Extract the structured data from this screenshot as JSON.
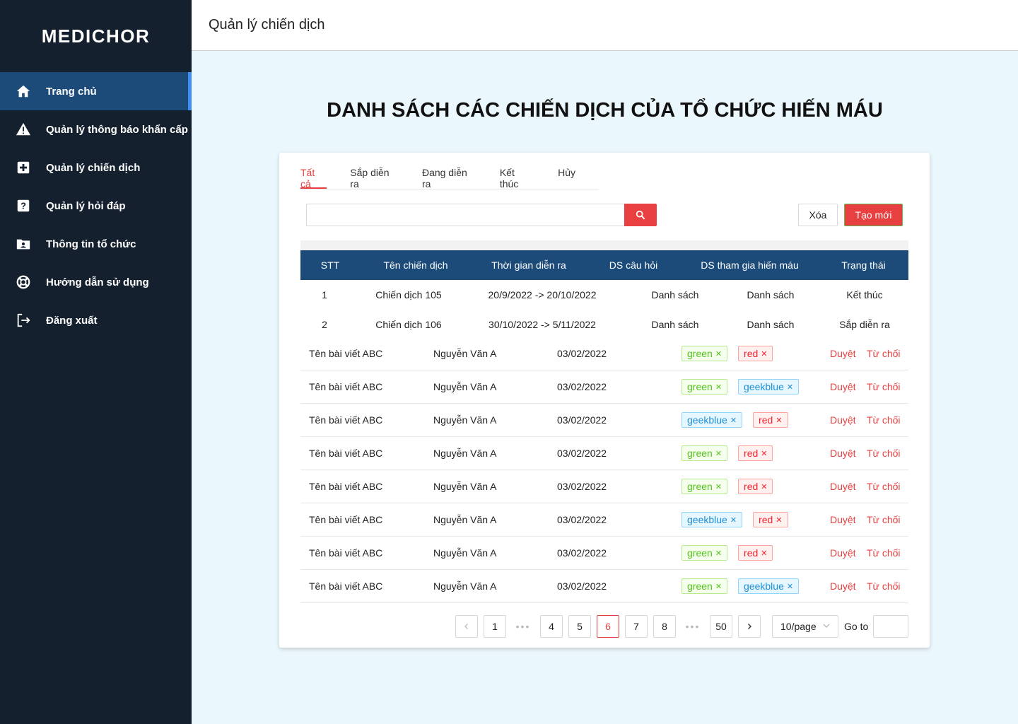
{
  "app": {
    "logo": "MEDICHOR"
  },
  "sidebar": {
    "items": [
      {
        "label": "Trang chủ",
        "icon": "home-icon"
      },
      {
        "label": "Quản lý thông báo khẩn cấp",
        "icon": "warning-icon"
      },
      {
        "label": "Quản lý chiến dịch",
        "icon": "medical-plus-icon"
      },
      {
        "label": "Quản lý hỏi đáp",
        "icon": "question-icon"
      },
      {
        "label": "Thông tin tổ chức",
        "icon": "folder-user-icon"
      },
      {
        "label": "Hướng dẫn sử dụng",
        "icon": "lifebuoy-icon"
      },
      {
        "label": "Đăng xuất",
        "icon": "logout-icon"
      }
    ],
    "active_index": 0
  },
  "header": {
    "title": "Quản lý chiến dịch"
  },
  "page": {
    "heading": "DANH SÁCH CÁC CHIẾN DỊCH CỦA TỔ CHỨC HIẾN MÁU"
  },
  "tabs": [
    "Tất cả",
    "Sắp diễn ra",
    "Đang diễn ra",
    "Kết thúc",
    "Hủy"
  ],
  "active_tab": 0,
  "search": {
    "value": "",
    "placeholder": ""
  },
  "actions": {
    "delete_label": "Xóa",
    "create_label": "Tạo mới"
  },
  "campaign_table": {
    "headers": [
      "STT",
      "Tên chiến dịch",
      "Thời gian diễn ra",
      "DS câu hỏi",
      "DS tham gia hiến máu",
      "Trạng thái"
    ],
    "rows": [
      {
        "stt": "1",
        "name": "Chiến dịch 105",
        "time": "20/9/2022 -> 20/10/2022",
        "questions": "Danh sách",
        "participants": "Danh sách",
        "status": "Kết thúc"
      },
      {
        "stt": "2",
        "name": "Chiến dịch 106",
        "time": "30/10/2022 -> 5/11/2022",
        "questions": "Danh sách",
        "participants": "Danh sách",
        "status": "Sắp diễn ra"
      }
    ]
  },
  "post_table": {
    "approve_label": "Duyệt",
    "reject_label": "Từ chối",
    "rows": [
      {
        "title": "Tên bài viết ABC",
        "author": "Nguyễn Văn A",
        "date": "03/02/2022",
        "tags": [
          "green",
          "red"
        ]
      },
      {
        "title": "Tên bài viết ABC",
        "author": "Nguyễn Văn A",
        "date": "03/02/2022",
        "tags": [
          "green",
          "geekblue"
        ]
      },
      {
        "title": "Tên bài viết ABC",
        "author": "Nguyễn Văn A",
        "date": "03/02/2022",
        "tags": [
          "geekblue",
          "red"
        ]
      },
      {
        "title": "Tên bài viết ABC",
        "author": "Nguyễn Văn A",
        "date": "03/02/2022",
        "tags": [
          "green",
          "red"
        ]
      },
      {
        "title": "Tên bài viết ABC",
        "author": "Nguyễn Văn A",
        "date": "03/02/2022",
        "tags": [
          "green",
          "red"
        ]
      },
      {
        "title": "Tên bài viết ABC",
        "author": "Nguyễn Văn A",
        "date": "03/02/2022",
        "tags": [
          "geekblue",
          "red"
        ]
      },
      {
        "title": "Tên bài viết ABC",
        "author": "Nguyễn Văn A",
        "date": "03/02/2022",
        "tags": [
          "green",
          "red"
        ]
      },
      {
        "title": "Tên bài viết ABC",
        "author": "Nguyễn Văn A",
        "date": "03/02/2022",
        "tags": [
          "green",
          "geekblue"
        ]
      }
    ]
  },
  "pagination": {
    "pages": [
      "1",
      "4",
      "5",
      "6",
      "7",
      "8",
      "50"
    ],
    "current": "6",
    "page_size": "10/page",
    "goto_label": "Go to",
    "goto_value": ""
  },
  "colors": {
    "sidebar_bg": "#14202e",
    "sidebar_active": "#1c4a79",
    "accent_red": "#e84040",
    "table_header": "#1c4a79",
    "page_bg": "#eaf7fc"
  }
}
